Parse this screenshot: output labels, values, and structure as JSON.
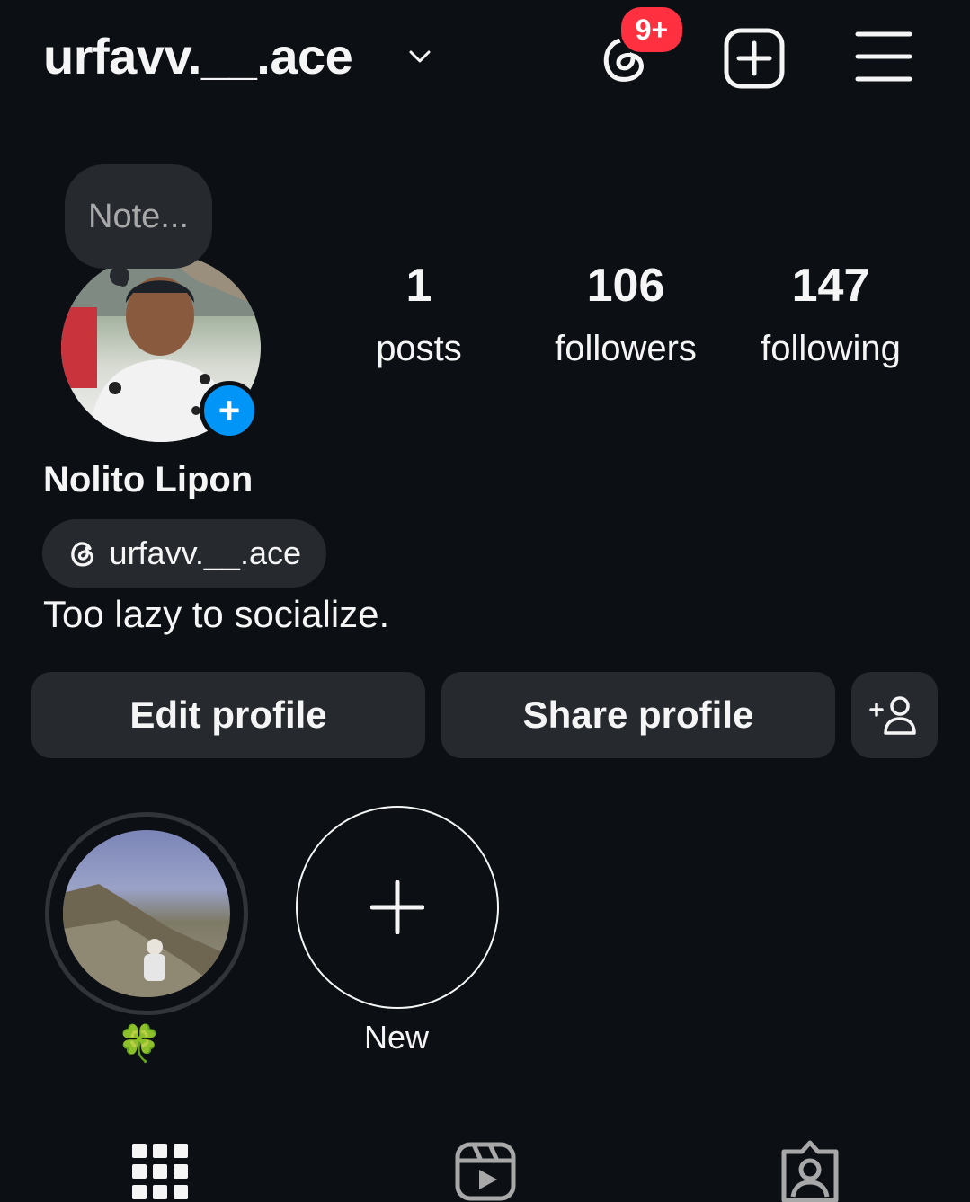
{
  "header": {
    "username": "urfavv.__.ace",
    "threads_badge": "9+"
  },
  "note": {
    "placeholder": "Note..."
  },
  "stats": [
    {
      "count": "1",
      "label": "posts"
    },
    {
      "count": "106",
      "label": "followers"
    },
    {
      "count": "147",
      "label": "following"
    }
  ],
  "profile": {
    "name": "Nolito Lipon",
    "threads_handle": "urfavv.__.ace",
    "bio": "Too lazy to socialize."
  },
  "actions": {
    "edit": "Edit profile",
    "share": "Share profile"
  },
  "highlights": [
    {
      "label": "🍀"
    },
    {
      "label": "New"
    }
  ],
  "colors": {
    "background": "#0c1014",
    "button": "#262a2f",
    "accent": "#0095f6",
    "badge": "#ff3040"
  },
  "icons": [
    "chevron-down-icon",
    "threads-icon",
    "create-icon",
    "menu-icon",
    "plus-icon",
    "add-person-icon",
    "grid-icon",
    "reels-icon",
    "tagged-icon"
  ]
}
